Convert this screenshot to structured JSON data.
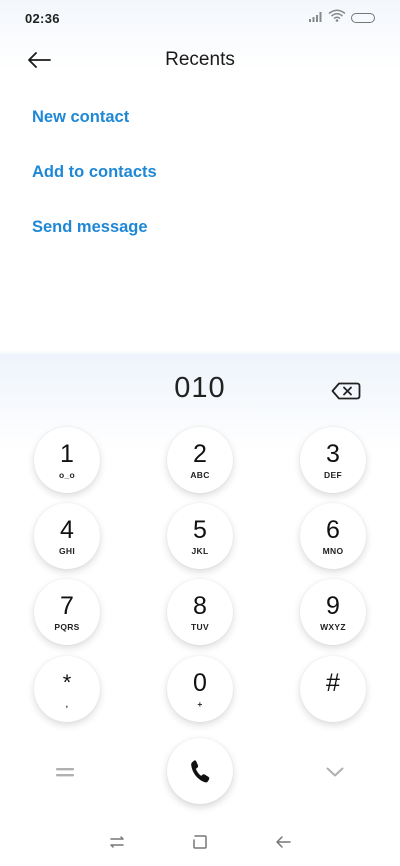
{
  "status_bar": {
    "time": "02:36",
    "icons": [
      "signal-icon",
      "wifi-icon",
      "battery-icon"
    ]
  },
  "header": {
    "title": "Recents",
    "back_icon": "arrow-left-icon"
  },
  "actions": [
    {
      "label": "New contact"
    },
    {
      "label": "Add to contacts"
    },
    {
      "label": "Send message"
    }
  ],
  "dialer": {
    "number": "010",
    "backspace_icon": "backspace-icon",
    "keys": [
      {
        "digit": "1",
        "letters": "o_o"
      },
      {
        "digit": "2",
        "letters": "ABC"
      },
      {
        "digit": "3",
        "letters": "DEF"
      },
      {
        "digit": "4",
        "letters": "GHI"
      },
      {
        "digit": "5",
        "letters": "JKL"
      },
      {
        "digit": "6",
        "letters": "MNO"
      },
      {
        "digit": "7",
        "letters": "PQRS"
      },
      {
        "digit": "8",
        "letters": "TUV"
      },
      {
        "digit": "9",
        "letters": "WXYZ"
      },
      {
        "digit": "*",
        "letters": ","
      },
      {
        "digit": "0",
        "letters": "+"
      },
      {
        "digit": "#",
        "letters": ""
      }
    ],
    "menu_icon": "menu-icon",
    "call_icon": "phone-icon",
    "collapse_icon": "chevron-down-icon"
  },
  "nav_bar": {
    "icons": [
      "recents-icon",
      "home-icon",
      "back-icon"
    ]
  },
  "colors": {
    "accent": "#1e88d6",
    "text": "#1a1a1a",
    "icon_gray": "#b0b0b0"
  }
}
